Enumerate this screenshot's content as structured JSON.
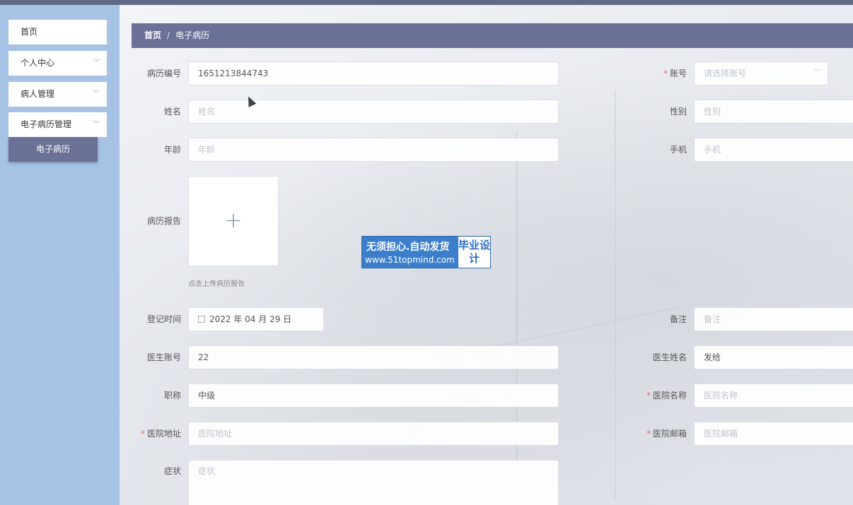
{
  "sidebar": {
    "items": [
      {
        "label": "首页",
        "has_chevron": false
      },
      {
        "label": "个人中心",
        "has_chevron": true
      },
      {
        "label": "病人管理",
        "has_chevron": true
      },
      {
        "label": "电子病历管理",
        "has_chevron": true
      }
    ],
    "active_subitem": "电子病历"
  },
  "breadcrumb": {
    "home": "首页",
    "separator": "/",
    "current": "电子病历"
  },
  "form": {
    "record_no": {
      "label": "病历编号",
      "value": "1651213844743"
    },
    "account": {
      "label": "账号",
      "placeholder": "请选择账号",
      "required": true
    },
    "name": {
      "label": "姓名",
      "placeholder": "姓名"
    },
    "gender": {
      "label": "性别",
      "placeholder": "性别"
    },
    "age": {
      "label": "年龄",
      "placeholder": "年龄"
    },
    "phone": {
      "label": "手机",
      "placeholder": "手机"
    },
    "report": {
      "label": "病历报告",
      "hint": "点击上传病历报告",
      "icon": "plus-icon"
    },
    "reg_time": {
      "label": "登记时间",
      "value": "2022 年 04 月 29 日",
      "icon": "calendar-icon"
    },
    "remark": {
      "label": "备注",
      "placeholder": "备注"
    },
    "doctor_account": {
      "label": "医生账号",
      "value": "22"
    },
    "doctor_name": {
      "label": "医生姓名",
      "value": "发给"
    },
    "title": {
      "label": "职称",
      "value": "中级"
    },
    "hospital_name": {
      "label": "医院名称",
      "placeholder": "医院名称",
      "required": true
    },
    "hospital_address": {
      "label": "医院地址",
      "placeholder": "医院地址",
      "required": true
    },
    "hospital_email": {
      "label": "医院邮箱",
      "placeholder": "医院邮箱",
      "required": true
    },
    "symptom": {
      "label": "症状",
      "placeholder": "症状"
    }
  },
  "watermark": {
    "line1": "无须担心.自动发货",
    "line2": "www.51topmind.com",
    "right": "毕业设计"
  },
  "colors": {
    "accent": "#6b7097",
    "sidebar": "#a6c3e6",
    "required": "#f56c6c"
  }
}
